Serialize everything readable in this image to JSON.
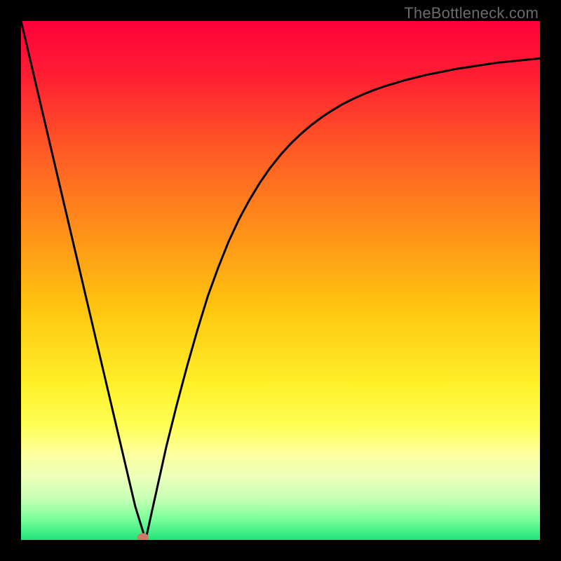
{
  "attribution": "TheBottleneck.com",
  "chart_data": {
    "type": "line",
    "title": "",
    "xlabel": "",
    "ylabel": "",
    "xlim": [
      0,
      100
    ],
    "ylim": [
      0,
      100
    ],
    "x": [
      0,
      2,
      4,
      6,
      8,
      10,
      12,
      14,
      16,
      18,
      20,
      22,
      24,
      26,
      28,
      30,
      32,
      34,
      36,
      38,
      40,
      42,
      44,
      46,
      48,
      50,
      52,
      54,
      56,
      58,
      60,
      62,
      64,
      66,
      68,
      70,
      72,
      74,
      76,
      78,
      80,
      82,
      84,
      86,
      88,
      90,
      92,
      94,
      96,
      98,
      100
    ],
    "values": [
      100,
      91.5,
      83,
      74.5,
      66,
      57.5,
      49,
      40.5,
      32,
      23.5,
      15,
      6.5,
      0,
      9,
      18,
      26,
      33.5,
      40.5,
      47,
      52.5,
      57.5,
      61.8,
      65.5,
      68.8,
      71.7,
      74.2,
      76.4,
      78.3,
      80,
      81.5,
      82.8,
      84,
      85,
      85.9,
      86.7,
      87.4,
      88,
      88.6,
      89.1,
      89.6,
      90,
      90.4,
      90.8,
      91.1,
      91.4,
      91.7,
      92,
      92.2,
      92.4,
      92.6,
      92.8
    ],
    "marker": {
      "x": 23.5,
      "y": 0.5
    },
    "gradient_stops": [
      {
        "pos": 0.0,
        "color": "#ff003a"
      },
      {
        "pos": 0.1,
        "color": "#ff1c33"
      },
      {
        "pos": 0.25,
        "color": "#ff5a25"
      },
      {
        "pos": 0.4,
        "color": "#ff8f1a"
      },
      {
        "pos": 0.55,
        "color": "#ffc40f"
      },
      {
        "pos": 0.7,
        "color": "#fff028"
      },
      {
        "pos": 0.78,
        "color": "#fffd55"
      },
      {
        "pos": 0.83,
        "color": "#fdff9b"
      },
      {
        "pos": 0.88,
        "color": "#ecffba"
      },
      {
        "pos": 0.92,
        "color": "#c6ffb4"
      },
      {
        "pos": 0.96,
        "color": "#7aff9a"
      },
      {
        "pos": 1.0,
        "color": "#21e37a"
      }
    ]
  }
}
